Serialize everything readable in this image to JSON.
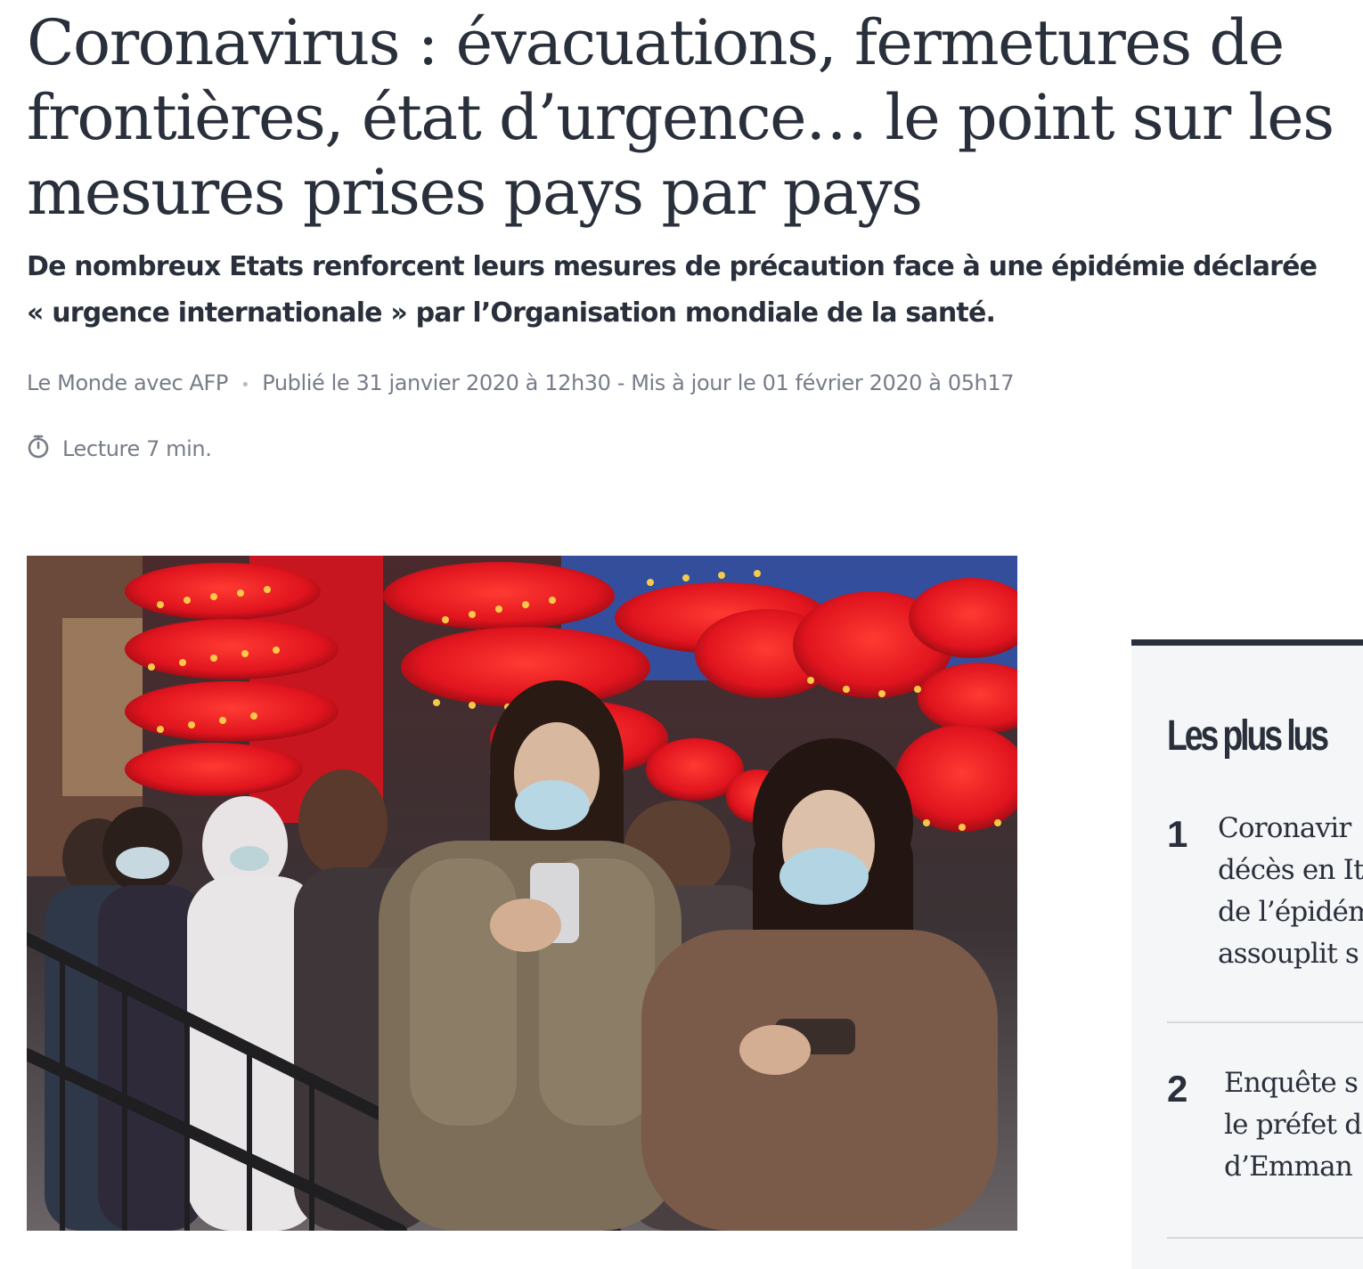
{
  "article": {
    "headline": "Coronavirus : évacuations, fermetures de frontières, état d’urgence… le point sur les mesures prises pays par pays",
    "standfirst_line1": "De nombreux Etats renforcent leurs mesures de précaution face à une épidémie déclarée",
    "standfirst_line2": "« urgence internationale » par l’Organisation mondiale de la santé.",
    "author": "Le Monde avec AFP",
    "separator": "•",
    "dates": "Publié le 31 janvier 2020 à 12h30 - Mis à jour le 01 février 2020 à 05h17",
    "reading_time": "Lecture 7 min.",
    "reading_icon": "stopwatch-icon",
    "photo_icon": "news-photo"
  },
  "most_read": {
    "title": "Les plus lus",
    "items": [
      {
        "rank": "1",
        "lines": [
          "Coronavir",
          "décès en It",
          "de l’épidém",
          "assouplit s"
        ]
      },
      {
        "rank": "2",
        "lines": [
          "Enquête s",
          "le préfet d",
          "d’Emman"
        ]
      }
    ]
  },
  "colors": {
    "text": "#2a303b",
    "meta": "#777d88",
    "aside_bg": "#f5f6f8",
    "lantern_red": "#e0141e"
  }
}
